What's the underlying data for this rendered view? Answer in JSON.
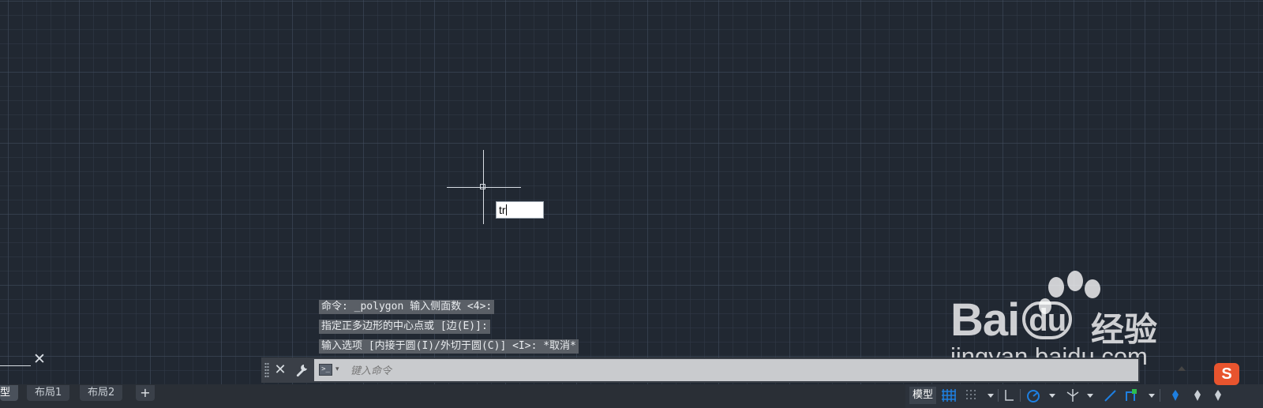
{
  "canvas": {
    "dynamic_input": {
      "value": "tr"
    }
  },
  "command_history": [
    "命令: _polygon 输入侧面数 <4>:",
    "指定正多边形的中心点或 [边(E)]:",
    "输入选项 [内接于圆(I)/外切于圆(C)] <I>: *取消*"
  ],
  "command_line": {
    "close_icon": "close-icon",
    "settings_icon": "wrench-icon",
    "prompt_icon": "command-prompt-icon",
    "placeholder": "键入命令"
  },
  "tabs": {
    "model": "型",
    "layout1": "布局1",
    "layout2": "布局2",
    "add": "+"
  },
  "status_bar": {
    "model_label": "模型",
    "accent_color": "#1e7fe0"
  },
  "watermark": {
    "logo_text": "Bai",
    "logo_du": "du",
    "cn_text": "经验",
    "url": "jingyan.baidu.com"
  },
  "ime_badge": "S",
  "colors": {
    "background": "#212832",
    "crosshair": "#d8dde3"
  }
}
